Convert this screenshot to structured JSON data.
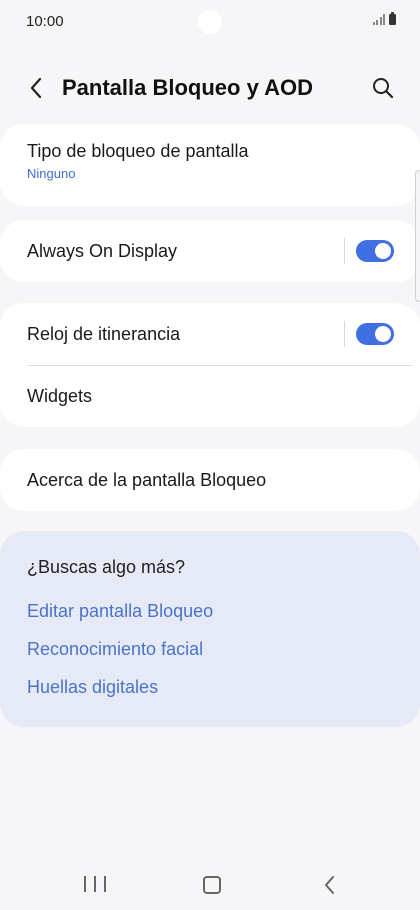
{
  "status_bar": {
    "time": "10:00",
    "icons": [
      "signal-icon",
      "battery-icon"
    ]
  },
  "header": {
    "title": "Pantalla Bloqueo y AOD",
    "back_icon": "chevron-left-icon",
    "search_icon": "search-icon"
  },
  "lock_type": {
    "label": "Tipo de bloqueo de pantalla",
    "value": "Ninguno"
  },
  "always_on_display": {
    "label": "Always On Display",
    "enabled": true
  },
  "roaming_clock": {
    "label": "Reloj de itinerancia",
    "enabled": true
  },
  "widgets": {
    "label": "Widgets"
  },
  "about": {
    "label": "Acerca de la pantalla Bloqueo"
  },
  "suggestions": {
    "title": "¿Buscas algo más?",
    "links": [
      "Editar pantalla Bloqueo",
      "Reconocimiento facial",
      "Huellas digitales"
    ]
  },
  "nav_bar": {
    "icons": [
      "recents-icon",
      "home-icon",
      "back-icon"
    ]
  },
  "colors": {
    "accent": "#3f6fe0",
    "link": "#4a73c8",
    "background": "#f6f6f8",
    "suggestion_card": "#e6eaf6"
  }
}
